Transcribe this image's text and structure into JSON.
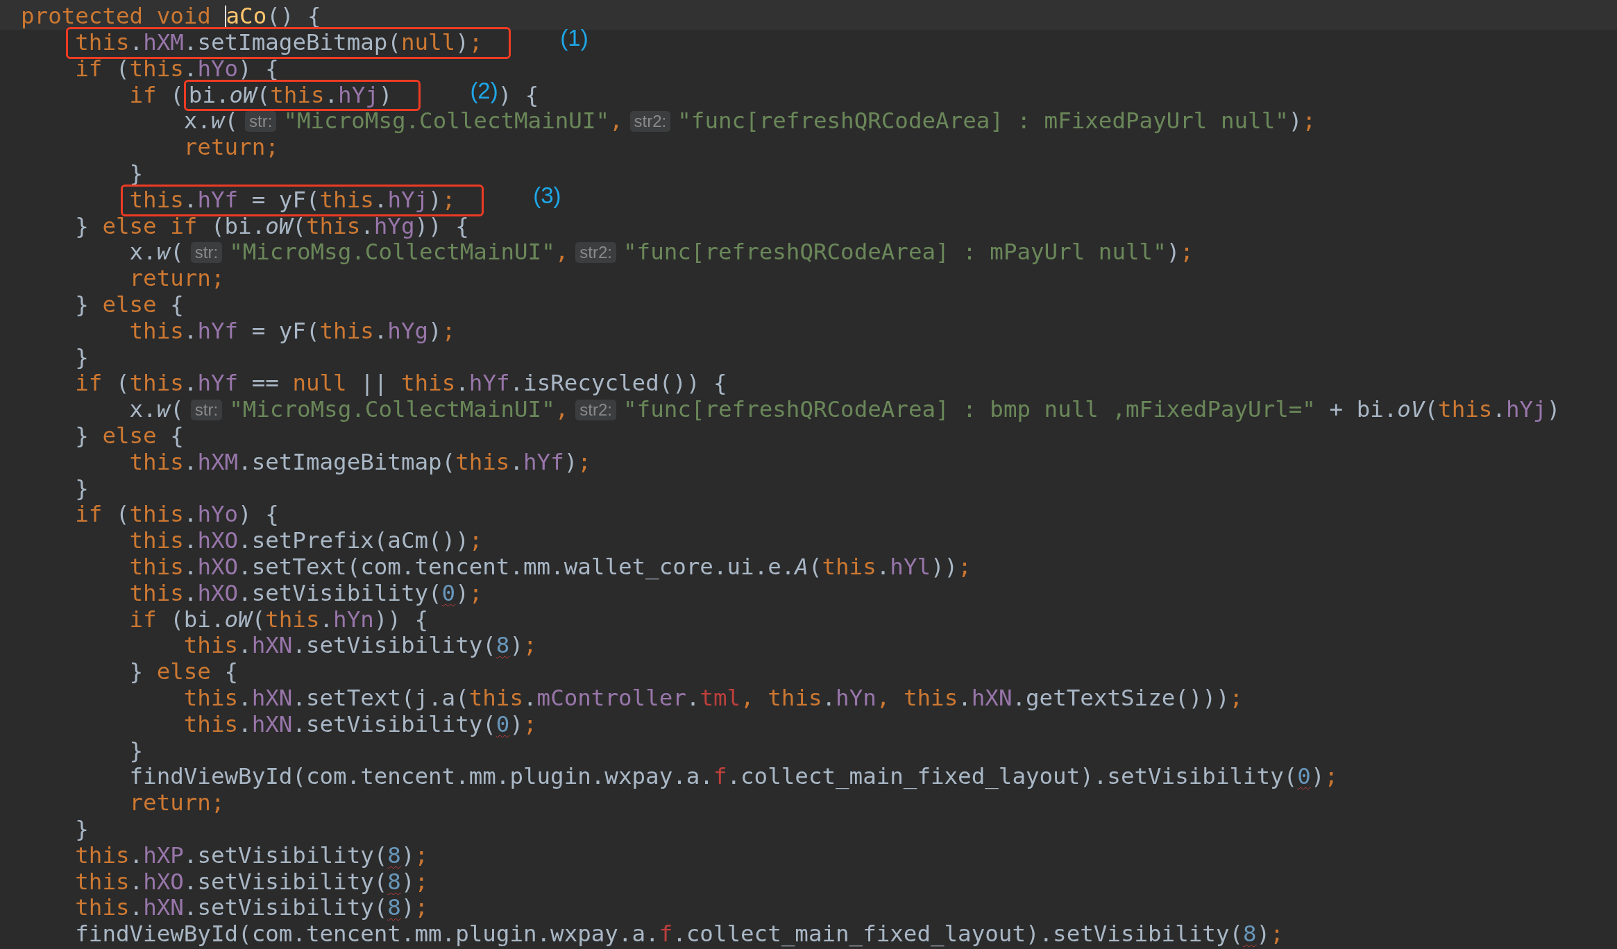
{
  "editor": {
    "lines": [
      {
        "current": true,
        "tokens": [
          {
            "kind": "keyword",
            "text": "protected void "
          },
          {
            "kind": "caret"
          },
          {
            "kind": "declaration",
            "text": "aCo"
          },
          {
            "kind": "plain",
            "text": "() {"
          }
        ]
      },
      {
        "tokens": [
          {
            "kind": "annotation",
            "label": "(1)",
            "tokens": [
              {
                "kind": "keyword",
                "text": "    this"
              },
              {
                "kind": "plain",
                "text": "."
              },
              {
                "kind": "field",
                "text": "hXM"
              },
              {
                "kind": "plain",
                "text": ".setImageBitmap("
              },
              {
                "kind": "keyword",
                "text": "null"
              },
              {
                "kind": "plain",
                "text": ")"
              },
              {
                "kind": "keyword",
                "text": ";"
              }
            ]
          }
        ]
      },
      {
        "tokens": [
          {
            "kind": "keyword",
            "text": "    if"
          },
          {
            "kind": "plain",
            "text": " ("
          },
          {
            "kind": "keyword",
            "text": "this"
          },
          {
            "kind": "plain",
            "text": "."
          },
          {
            "kind": "field",
            "text": "hYo"
          },
          {
            "kind": "plain",
            "text": ") {"
          }
        ]
      },
      {
        "tokens": [
          {
            "kind": "keyword",
            "text": "        if"
          },
          {
            "kind": "plain",
            "text": " ("
          },
          {
            "kind": "annotation",
            "label": "(2)",
            "tokens": [
              {
                "kind": "plain",
                "text": "bi."
              },
              {
                "kind": "italic",
                "text": "oW"
              },
              {
                "kind": "plain",
                "text": "("
              },
              {
                "kind": "keyword",
                "text": "this"
              },
              {
                "kind": "plain",
                "text": "."
              },
              {
                "kind": "field",
                "text": "hYj"
              },
              {
                "kind": "plain",
                "text": ")"
              }
            ]
          },
          {
            "kind": "plain",
            "text": ") {"
          }
        ]
      },
      {
        "tokens": [
          {
            "kind": "plain",
            "text": "            x."
          },
          {
            "kind": "italic",
            "text": "w"
          },
          {
            "kind": "plain",
            "text": "("
          },
          {
            "kind": "hint",
            "text": "str:"
          },
          {
            "kind": "string",
            "text": "\"MicroMsg.CollectMainUI\""
          },
          {
            "kind": "keyword",
            "text": ","
          },
          {
            "kind": "hint",
            "text": "str2:"
          },
          {
            "kind": "string",
            "text": "\"func[refreshQRCodeArea] : mFixedPayUrl null\""
          },
          {
            "kind": "plain",
            "text": ")"
          },
          {
            "kind": "keyword",
            "text": ";"
          }
        ]
      },
      {
        "tokens": [
          {
            "kind": "keyword",
            "text": "            return;"
          }
        ]
      },
      {
        "tokens": [
          {
            "kind": "plain",
            "text": "        }"
          }
        ]
      },
      {
        "tokens": [
          {
            "kind": "annotation",
            "label": "(3)",
            "tokens": [
              {
                "kind": "keyword",
                "text": "        this"
              },
              {
                "kind": "plain",
                "text": "."
              },
              {
                "kind": "field",
                "text": "hYf"
              },
              {
                "kind": "plain",
                "text": " = yF("
              },
              {
                "kind": "keyword",
                "text": "this"
              },
              {
                "kind": "plain",
                "text": "."
              },
              {
                "kind": "field",
                "text": "hYj"
              },
              {
                "kind": "plain",
                "text": ")"
              },
              {
                "kind": "keyword",
                "text": ";"
              }
            ]
          }
        ]
      },
      {
        "tokens": [
          {
            "kind": "plain",
            "text": "    } "
          },
          {
            "kind": "keyword",
            "text": "else if"
          },
          {
            "kind": "plain",
            "text": " (bi."
          },
          {
            "kind": "italic",
            "text": "oW"
          },
          {
            "kind": "plain",
            "text": "("
          },
          {
            "kind": "keyword",
            "text": "this"
          },
          {
            "kind": "plain",
            "text": "."
          },
          {
            "kind": "field",
            "text": "hYg"
          },
          {
            "kind": "plain",
            "text": ")) {"
          }
        ]
      },
      {
        "tokens": [
          {
            "kind": "plain",
            "text": "        x."
          },
          {
            "kind": "italic",
            "text": "w"
          },
          {
            "kind": "plain",
            "text": "("
          },
          {
            "kind": "hint",
            "text": "str:"
          },
          {
            "kind": "string",
            "text": "\"MicroMsg.CollectMainUI\""
          },
          {
            "kind": "keyword",
            "text": ","
          },
          {
            "kind": "hint",
            "text": "str2:"
          },
          {
            "kind": "string",
            "text": "\"func[refreshQRCodeArea] : mPayUrl null\""
          },
          {
            "kind": "plain",
            "text": ")"
          },
          {
            "kind": "keyword",
            "text": ";"
          }
        ]
      },
      {
        "tokens": [
          {
            "kind": "keyword",
            "text": "        return;"
          }
        ]
      },
      {
        "tokens": [
          {
            "kind": "plain",
            "text": "    } "
          },
          {
            "kind": "keyword",
            "text": "else"
          },
          {
            "kind": "plain",
            "text": " {"
          }
        ]
      },
      {
        "tokens": [
          {
            "kind": "keyword",
            "text": "        this"
          },
          {
            "kind": "plain",
            "text": "."
          },
          {
            "kind": "field",
            "text": "hYf"
          },
          {
            "kind": "plain",
            "text": " = yF("
          },
          {
            "kind": "keyword",
            "text": "this"
          },
          {
            "kind": "plain",
            "text": "."
          },
          {
            "kind": "field",
            "text": "hYg"
          },
          {
            "kind": "plain",
            "text": ")"
          },
          {
            "kind": "keyword",
            "text": ";"
          }
        ]
      },
      {
        "tokens": [
          {
            "kind": "plain",
            "text": "    }"
          }
        ]
      },
      {
        "tokens": [
          {
            "kind": "keyword",
            "text": "    if"
          },
          {
            "kind": "plain",
            "text": " ("
          },
          {
            "kind": "keyword",
            "text": "this"
          },
          {
            "kind": "plain",
            "text": "."
          },
          {
            "kind": "field",
            "text": "hYf"
          },
          {
            "kind": "plain",
            "text": " == "
          },
          {
            "kind": "keyword",
            "text": "null"
          },
          {
            "kind": "plain",
            "text": " || "
          },
          {
            "kind": "keyword",
            "text": "this"
          },
          {
            "kind": "plain",
            "text": "."
          },
          {
            "kind": "field",
            "text": "hYf"
          },
          {
            "kind": "plain",
            "text": ".isRecycled()) {"
          }
        ]
      },
      {
        "tokens": [
          {
            "kind": "plain",
            "text": "        x."
          },
          {
            "kind": "italic",
            "text": "w"
          },
          {
            "kind": "plain",
            "text": "("
          },
          {
            "kind": "hint",
            "text": "str:"
          },
          {
            "kind": "string",
            "text": "\"MicroMsg.CollectMainUI\""
          },
          {
            "kind": "keyword",
            "text": ","
          },
          {
            "kind": "hint",
            "text": "str2:"
          },
          {
            "kind": "string",
            "text": "\"func[refreshQRCodeArea] : bmp null ,mFixedPayUrl=\""
          },
          {
            "kind": "plain",
            "text": " + bi."
          },
          {
            "kind": "italic",
            "text": "oV"
          },
          {
            "kind": "plain",
            "text": "("
          },
          {
            "kind": "keyword",
            "text": "this"
          },
          {
            "kind": "plain",
            "text": "."
          },
          {
            "kind": "field",
            "text": "hYj"
          },
          {
            "kind": "plain",
            "text": ")"
          }
        ]
      },
      {
        "tokens": [
          {
            "kind": "plain",
            "text": "    } "
          },
          {
            "kind": "keyword",
            "text": "else"
          },
          {
            "kind": "plain",
            "text": " {"
          }
        ]
      },
      {
        "tokens": [
          {
            "kind": "keyword",
            "text": "        this"
          },
          {
            "kind": "plain",
            "text": "."
          },
          {
            "kind": "field",
            "text": "hXM"
          },
          {
            "kind": "plain",
            "text": ".setImageBitmap("
          },
          {
            "kind": "keyword",
            "text": "this"
          },
          {
            "kind": "plain",
            "text": "."
          },
          {
            "kind": "field",
            "text": "hYf"
          },
          {
            "kind": "plain",
            "text": ")"
          },
          {
            "kind": "keyword",
            "text": ";"
          }
        ]
      },
      {
        "tokens": [
          {
            "kind": "plain",
            "text": "    }"
          }
        ]
      },
      {
        "tokens": [
          {
            "kind": "keyword",
            "text": "    if"
          },
          {
            "kind": "plain",
            "text": " ("
          },
          {
            "kind": "keyword",
            "text": "this"
          },
          {
            "kind": "plain",
            "text": "."
          },
          {
            "kind": "field",
            "text": "hYo"
          },
          {
            "kind": "plain",
            "text": ") {"
          }
        ]
      },
      {
        "tokens": [
          {
            "kind": "keyword",
            "text": "        this"
          },
          {
            "kind": "plain",
            "text": "."
          },
          {
            "kind": "field",
            "text": "hXO"
          },
          {
            "kind": "plain",
            "text": ".setPrefix(aCm())"
          },
          {
            "kind": "keyword",
            "text": ";"
          }
        ]
      },
      {
        "tokens": [
          {
            "kind": "keyword",
            "text": "        this"
          },
          {
            "kind": "plain",
            "text": "."
          },
          {
            "kind": "field",
            "text": "hXO"
          },
          {
            "kind": "plain",
            "text": ".setText(com.tencent.mm.wallet_core.ui.e."
          },
          {
            "kind": "italic",
            "text": "A"
          },
          {
            "kind": "plain",
            "text": "("
          },
          {
            "kind": "keyword",
            "text": "this"
          },
          {
            "kind": "plain",
            "text": "."
          },
          {
            "kind": "field",
            "text": "hYl"
          },
          {
            "kind": "plain",
            "text": "))"
          },
          {
            "kind": "keyword",
            "text": ";"
          }
        ]
      },
      {
        "tokens": [
          {
            "kind": "keyword",
            "text": "        this"
          },
          {
            "kind": "plain",
            "text": "."
          },
          {
            "kind": "field",
            "text": "hXO"
          },
          {
            "kind": "plain",
            "text": ".setVisibility("
          },
          {
            "kind": "number",
            "text": "0"
          },
          {
            "kind": "plain",
            "text": ")"
          },
          {
            "kind": "keyword",
            "text": ";"
          }
        ]
      },
      {
        "tokens": [
          {
            "kind": "keyword",
            "text": "        if"
          },
          {
            "kind": "plain",
            "text": " (bi."
          },
          {
            "kind": "italic",
            "text": "oW"
          },
          {
            "kind": "plain",
            "text": "("
          },
          {
            "kind": "keyword",
            "text": "this"
          },
          {
            "kind": "plain",
            "text": "."
          },
          {
            "kind": "field",
            "text": "hYn"
          },
          {
            "kind": "plain",
            "text": ")) {"
          }
        ]
      },
      {
        "tokens": [
          {
            "kind": "keyword",
            "text": "            this"
          },
          {
            "kind": "plain",
            "text": "."
          },
          {
            "kind": "field",
            "text": "hXN"
          },
          {
            "kind": "plain",
            "text": ".setVisibility("
          },
          {
            "kind": "number",
            "text": "8"
          },
          {
            "kind": "plain",
            "text": ")"
          },
          {
            "kind": "keyword",
            "text": ";"
          }
        ]
      },
      {
        "tokens": [
          {
            "kind": "plain",
            "text": "        } "
          },
          {
            "kind": "keyword",
            "text": "else"
          },
          {
            "kind": "plain",
            "text": " {"
          }
        ]
      },
      {
        "tokens": [
          {
            "kind": "keyword",
            "text": "            this"
          },
          {
            "kind": "plain",
            "text": "."
          },
          {
            "kind": "field",
            "text": "hXN"
          },
          {
            "kind": "plain",
            "text": ".setText(j.a("
          },
          {
            "kind": "keyword",
            "text": "this"
          },
          {
            "kind": "plain",
            "text": "."
          },
          {
            "kind": "field",
            "text": "mController"
          },
          {
            "kind": "plain",
            "text": "."
          },
          {
            "kind": "error",
            "text": "tml"
          },
          {
            "kind": "keyword",
            "text": ", this"
          },
          {
            "kind": "plain",
            "text": "."
          },
          {
            "kind": "field",
            "text": "hYn"
          },
          {
            "kind": "keyword",
            "text": ", this"
          },
          {
            "kind": "plain",
            "text": "."
          },
          {
            "kind": "field",
            "text": "hXN"
          },
          {
            "kind": "plain",
            "text": ".getTextSize()))"
          },
          {
            "kind": "keyword",
            "text": ";"
          }
        ]
      },
      {
        "tokens": [
          {
            "kind": "keyword",
            "text": "            this"
          },
          {
            "kind": "plain",
            "text": "."
          },
          {
            "kind": "field",
            "text": "hXN"
          },
          {
            "kind": "plain",
            "text": ".setVisibility("
          },
          {
            "kind": "number",
            "text": "0"
          },
          {
            "kind": "plain",
            "text": ")"
          },
          {
            "kind": "keyword",
            "text": ";"
          }
        ]
      },
      {
        "tokens": [
          {
            "kind": "plain",
            "text": "        }"
          }
        ]
      },
      {
        "tokens": [
          {
            "kind": "plain",
            "text": "        findViewById(com.tencent.mm.plugin.wxpay.a."
          },
          {
            "kind": "error",
            "text": "f"
          },
          {
            "kind": "plain",
            "text": ".collect_main_fixed_layout).setVisibility("
          },
          {
            "kind": "number",
            "text": "0"
          },
          {
            "kind": "plain",
            "text": ")"
          },
          {
            "kind": "keyword",
            "text": ";"
          }
        ]
      },
      {
        "tokens": [
          {
            "kind": "keyword",
            "text": "        return;"
          }
        ]
      },
      {
        "tokens": [
          {
            "kind": "plain",
            "text": "    }"
          }
        ]
      },
      {
        "tokens": [
          {
            "kind": "keyword",
            "text": "    this"
          },
          {
            "kind": "plain",
            "text": "."
          },
          {
            "kind": "field",
            "text": "hXP"
          },
          {
            "kind": "plain",
            "text": ".setVisibility("
          },
          {
            "kind": "number",
            "text": "8"
          },
          {
            "kind": "plain",
            "text": ")"
          },
          {
            "kind": "keyword",
            "text": ";"
          }
        ]
      },
      {
        "tokens": [
          {
            "kind": "keyword",
            "text": "    this"
          },
          {
            "kind": "plain",
            "text": "."
          },
          {
            "kind": "field",
            "text": "hXO"
          },
          {
            "kind": "plain",
            "text": ".setVisibility("
          },
          {
            "kind": "number",
            "text": "8"
          },
          {
            "kind": "plain",
            "text": ")"
          },
          {
            "kind": "keyword",
            "text": ";"
          }
        ]
      },
      {
        "tokens": [
          {
            "kind": "keyword",
            "text": "    this"
          },
          {
            "kind": "plain",
            "text": "."
          },
          {
            "kind": "field",
            "text": "hXN"
          },
          {
            "kind": "plain",
            "text": ".setVisibility("
          },
          {
            "kind": "number",
            "text": "8"
          },
          {
            "kind": "plain",
            "text": ")"
          },
          {
            "kind": "keyword",
            "text": ";"
          }
        ]
      },
      {
        "tokens": [
          {
            "kind": "plain",
            "text": "    findViewById(com.tencent.mm.plugin.wxpay.a."
          },
          {
            "kind": "error",
            "text": "f"
          },
          {
            "kind": "plain",
            "text": ".collect_main_fixed_layout).setVisibility("
          },
          {
            "kind": "number",
            "text": "8"
          },
          {
            "kind": "plain",
            "text": ")"
          },
          {
            "kind": "keyword",
            "text": ";"
          }
        ]
      }
    ]
  }
}
